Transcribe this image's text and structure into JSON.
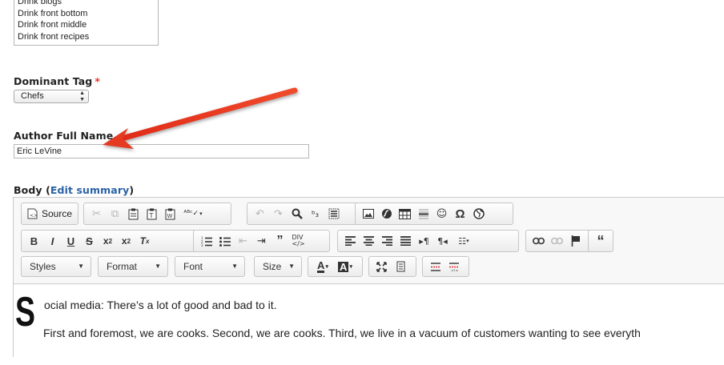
{
  "category_list": {
    "options": [
      "Drink blogs",
      "Drink front bottom",
      "Drink front middle",
      "Drink front recipes"
    ]
  },
  "dominant_tag": {
    "label": "Dominant Tag",
    "required_marker": "*",
    "selected": "Chefs"
  },
  "author": {
    "label": "Author Full Name",
    "value": "Eric LeVine"
  },
  "body": {
    "label": "Body",
    "paren_open": "(",
    "edit_summary": "Edit summary",
    "paren_close": ")"
  },
  "toolbar": {
    "source_label": "Source",
    "styles_label": "Styles",
    "format_label": "Format",
    "font_label": "Font",
    "size_label": "Size"
  },
  "content": {
    "dropcap": "S",
    "line1": "ocial media: There’s a lot of good and bad to it.",
    "line2": "First and foremost, we are cooks. Second, we are cooks. Third, we live in a vacuum of customers wanting to see everyth"
  },
  "colors": {
    "arrow": "#e53a22",
    "link": "#2a62a6",
    "required": "#e32"
  }
}
